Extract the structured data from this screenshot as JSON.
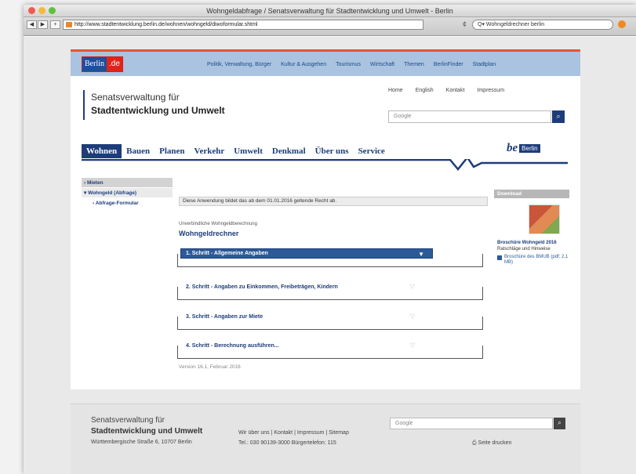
{
  "browser": {
    "window_title": "Wohngeldabfrage / Senatsverwaltung für Stadtentwicklung und Umwelt - Berlin",
    "url": "http://www.stadtentwicklung.berlin.de/wohnen/wohngeld/diwoformular.shtml",
    "search_query": "Wohngeldrechner berlin",
    "back_label": "◀",
    "forward_label": "▶",
    "add_label": "+",
    "reload_label": "¢"
  },
  "site": {
    "logo_text": "Berlin",
    "logo_suffix": ".de",
    "top_nav": [
      "Politik, Verwaltung, Bürger",
      "Kultur & Ausgehen",
      "Tourismus",
      "Wirtschaft",
      "Themen",
      "BerlinFinder",
      "Stadtplan"
    ],
    "org_line1": "Senatsverwaltung für",
    "org_line2": "Stadtentwicklung und Umwelt",
    "service_links": [
      "Home",
      "English",
      "Kontakt",
      "Impressum"
    ],
    "search_placeholder": "Google",
    "main_nav": [
      "Wohnen",
      "Bauen",
      "Planen",
      "Verkehr",
      "Umwelt",
      "Denkmal",
      "Über uns",
      "Service"
    ],
    "be_logo": "be",
    "be_logo_badge": "Berlin"
  },
  "sidebar": {
    "items": [
      "› Mieten",
      "▾ Wohngeld (Abfrage)",
      "› Abfrage-Formular"
    ]
  },
  "main": {
    "notice": "Diese Anwendung bildet das ab dem 01.01.2016 geltende Recht ab.",
    "calc_subtitle": "Unverbindliche Wohngeldberechnung",
    "calc_title": "Wohngeldrechner",
    "steps": [
      "1. Schritt - Allgemeine Angaben",
      "2. Schritt - Angaben zu Einkommen, Freibeträgen, Kindern",
      "3. Schritt - Angaben zur Miete",
      "4. Schritt - Berechnung ausführen..."
    ],
    "version": "Version 16.1, Februar 2016"
  },
  "download": {
    "heading": "Download",
    "title": "Broschüre Wohngeld 2016",
    "subtitle": "Ratschläge und Hinweise",
    "link": "Broschüre des BMUB (pdf; 2,1 MB)"
  },
  "footer": {
    "org_line1": "Senatsverwaltung für",
    "org_line2": "Stadtentwicklung und Umwelt",
    "address": "Württembergische Straße 6, 10707 Berlin",
    "links": "Wir über uns | Kontakt | Impressum | Sitemap",
    "tel": "Tel.: 030 90139-3000   Bürgertelefon: 115",
    "search_placeholder": "Google",
    "print": "Seite drucken"
  },
  "colors": {
    "brand_blue": "#1d3c7a",
    "berlin_red": "#e2231a",
    "banner_blue": "#a9c3e0"
  }
}
